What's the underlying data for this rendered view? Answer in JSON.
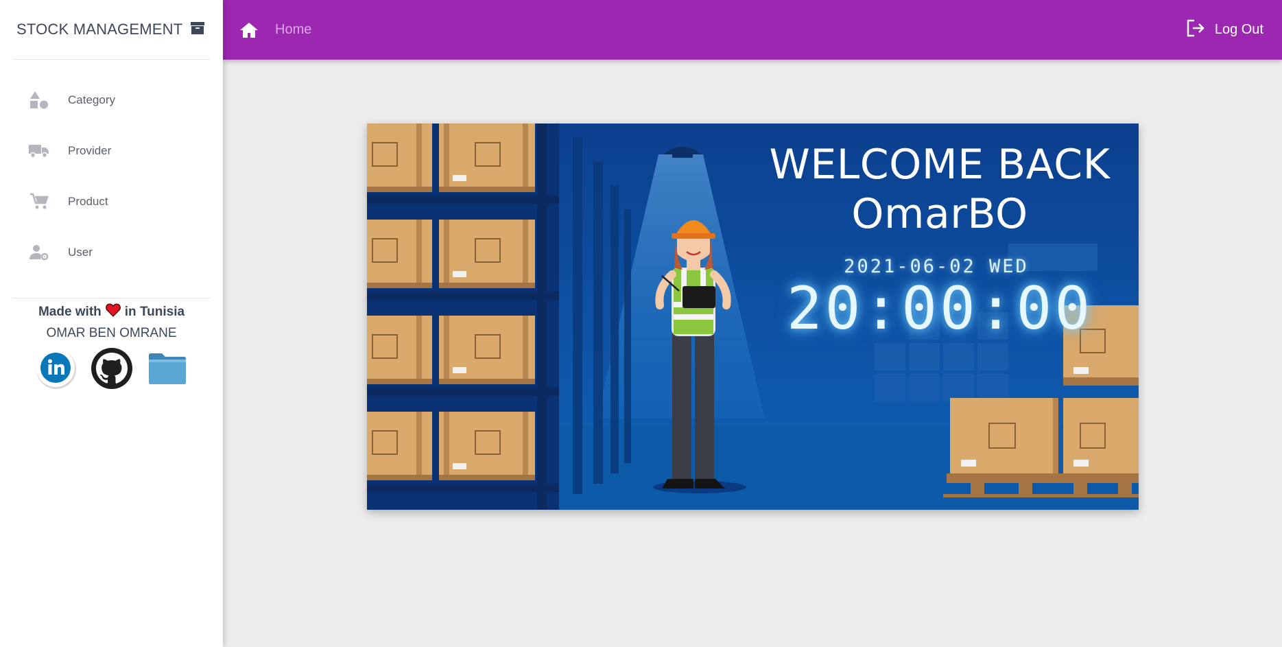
{
  "app": {
    "title": "STOCK MANAGEMENT",
    "icon": "archive-icon"
  },
  "sidebar": {
    "items": [
      {
        "label": "Category",
        "icon": "shapes-icon"
      },
      {
        "label": "Provider",
        "icon": "truck-icon"
      },
      {
        "label": "Product",
        "icon": "cart-icon"
      },
      {
        "label": "User",
        "icon": "user-settings-icon"
      }
    ],
    "credits": {
      "made_with": "Made with",
      "heart_icon": "heart-icon",
      "in_place": "in Tunisia",
      "author": "OMAR BEN OMRANE"
    },
    "socials": [
      {
        "name": "linkedin",
        "icon": "linkedin-icon"
      },
      {
        "name": "github",
        "icon": "github-icon"
      },
      {
        "name": "folder",
        "icon": "folder-icon"
      }
    ]
  },
  "topbar": {
    "home_label": "Home",
    "logout_label": "Log Out",
    "color": "#9c27b0"
  },
  "banner": {
    "welcome_line": "WELCOME BACK",
    "username": "OmarBO",
    "date": "2021-06-02 WED",
    "time": "20:00:00"
  }
}
